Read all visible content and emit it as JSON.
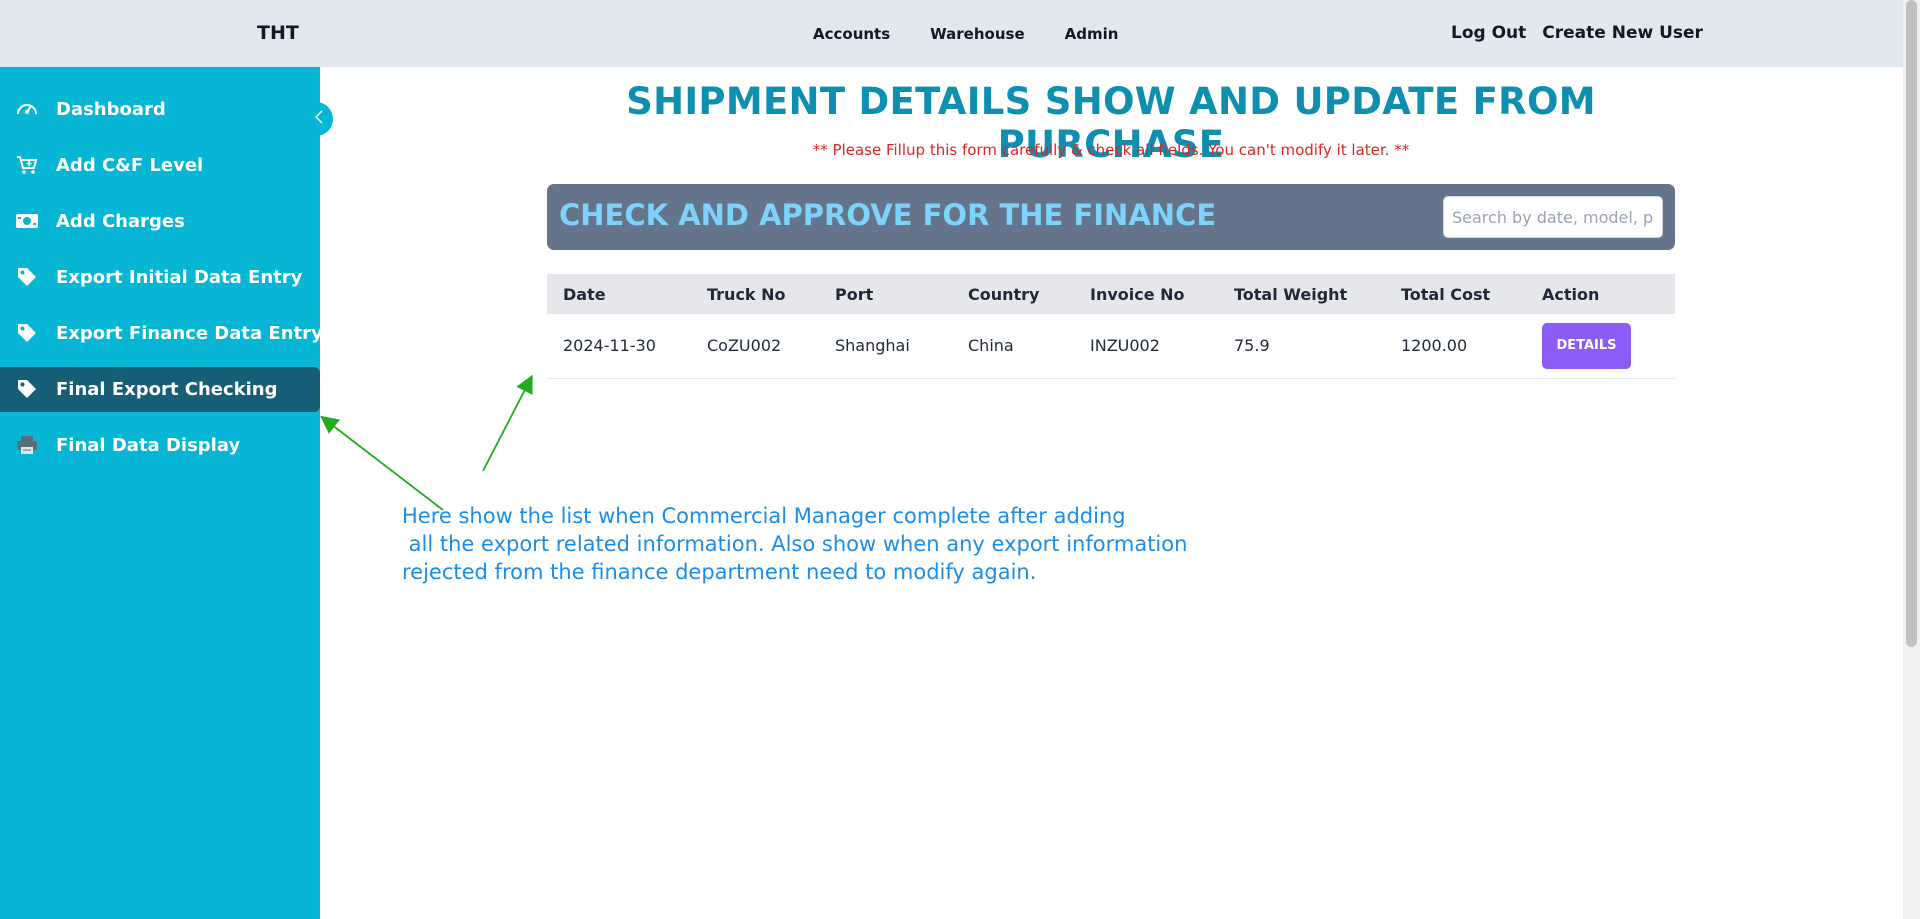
{
  "header": {
    "brand": "THT",
    "nav": [
      "Accounts",
      "Warehouse",
      "Admin"
    ],
    "logout_label": "Log Out",
    "create_user_label": "Create New User"
  },
  "sidebar": {
    "items": [
      {
        "label": "Dashboard",
        "icon": "dashboard-icon"
      },
      {
        "label": "Add C&F Level",
        "icon": "cart-icon"
      },
      {
        "label": "Add Charges",
        "icon": "money-icon"
      },
      {
        "label": "Export Initial Data Entry",
        "icon": "tag-icon"
      },
      {
        "label": "Export Finance Data Entry",
        "icon": "tag-icon"
      },
      {
        "label": "Final Export Checking",
        "icon": "tag-icon",
        "active": true
      },
      {
        "label": "Final Data Display",
        "icon": "printer-icon"
      }
    ]
  },
  "main": {
    "title": "SHIPMENT DETAILS SHOW AND UPDATE FROM PURCHASE",
    "warning": "** Please Fillup this form carefully & check all fields. You can't modify it later. **",
    "panel_title": "CHECK AND APPROVE FOR THE FINANCE",
    "search_placeholder": "Search by date, model, port...",
    "table": {
      "headers": [
        "Date",
        "Truck No",
        "Port",
        "Country",
        "Invoice No",
        "Total Weight",
        "Total Cost",
        "Action"
      ],
      "rows": [
        {
          "date": "2024-11-30",
          "truck_no": "CoZU002",
          "port": "Shanghai",
          "country": "China",
          "invoice_no": "INZU002",
          "total_weight": "75.9",
          "total_cost": "1200.00",
          "action_label": "DETAILS"
        }
      ]
    }
  },
  "annotation": {
    "text": "Here show the list when Commercial Manager complete after adding\n all the export related information. Also show when any export information\nrejected from the finance department need to modify again."
  },
  "colors": {
    "sidebar": "#06b6d4",
    "sidebar_active": "#155e75",
    "title": "#0e8fb0",
    "panel": "#64748b",
    "details_button": "#8b5cf6",
    "annotation_text": "#1d8de8",
    "annotation_arrow": "#22aa22"
  }
}
